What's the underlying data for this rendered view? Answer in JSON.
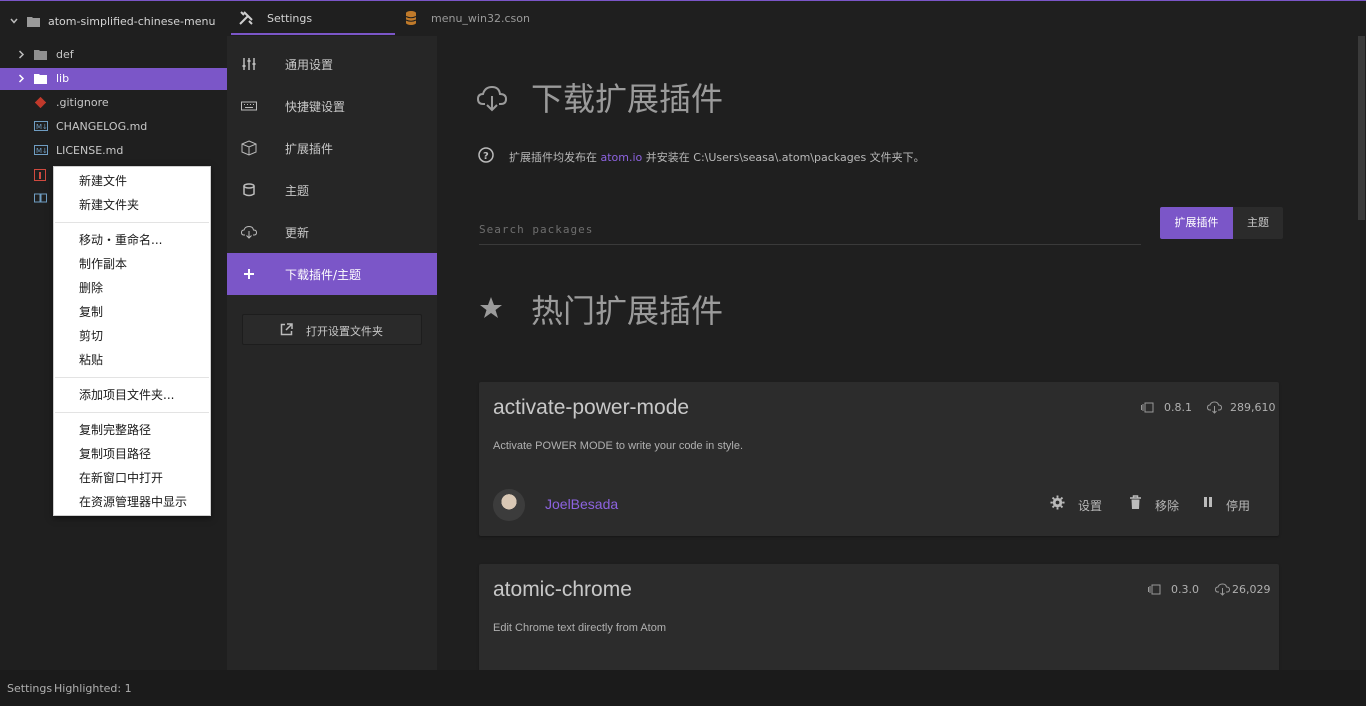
{
  "tree": {
    "root": "atom-simplified-chinese-menu",
    "items": [
      {
        "label": "def",
        "kind": "folder"
      },
      {
        "label": "lib",
        "kind": "folder",
        "selected": true
      },
      {
        "label": ".gitignore",
        "kind": "git"
      },
      {
        "label": "CHANGELOG.md",
        "kind": "markdown"
      },
      {
        "label": "LICENSE.md",
        "kind": "markdown"
      }
    ]
  },
  "context_menu": {
    "items": [
      "新建文件",
      "新建文件夹",
      "移动・重命名...",
      "制作副本",
      "删除",
      "复制",
      "剪切",
      "粘贴",
      "添加项目文件夹...",
      "复制完整路径",
      "复制项目路径",
      "在新窗口中打开",
      "在资源管理器中显示"
    ]
  },
  "tabs": [
    {
      "label": "Settings",
      "icon": "tools-icon",
      "active": true
    },
    {
      "label": "menu_win32.cson",
      "icon": "database-icon",
      "active": false
    }
  ],
  "settings_nav": {
    "items": [
      {
        "label": "通用设置",
        "icon": "sliders-icon"
      },
      {
        "label": "快捷键设置",
        "icon": "keyboard-icon"
      },
      {
        "label": "扩展插件",
        "icon": "package-icon"
      },
      {
        "label": "主题",
        "icon": "paintcan-icon"
      },
      {
        "label": "更新",
        "icon": "cloud-download-icon"
      },
      {
        "label": "下载插件/主题",
        "icon": "plus-icon",
        "active": true
      }
    ],
    "open_folder_label": "打开设置文件夹"
  },
  "install": {
    "title": "下载扩展插件",
    "info_prefix": "扩展插件均发布在",
    "info_link": "atom.io",
    "info_suffix": "并安装在 C:\\Users\\seasa\\.atom\\packages 文件夹下。",
    "search_placeholder": "Search packages",
    "toggle_packages": "扩展插件",
    "toggle_themes": "主题"
  },
  "featured": {
    "title": "热门扩展插件",
    "packages": [
      {
        "name": "activate-power-mode",
        "version": "0.8.1",
        "downloads": "289,610",
        "description": "Activate POWER MODE to write your code in style.",
        "author": "JoelBesada",
        "actions": [
          "设置",
          "移除",
          "停用"
        ]
      },
      {
        "name": "atomic-chrome",
        "version": "0.3.0",
        "downloads": "26,029",
        "description": "Edit Chrome text directly from Atom"
      }
    ]
  },
  "status": {
    "left": "Settings",
    "highlight": "Highlighted: 1"
  },
  "colors": {
    "accent": "#7b56c8",
    "link": "#8d63e0",
    "background": "#1f1f1f"
  }
}
